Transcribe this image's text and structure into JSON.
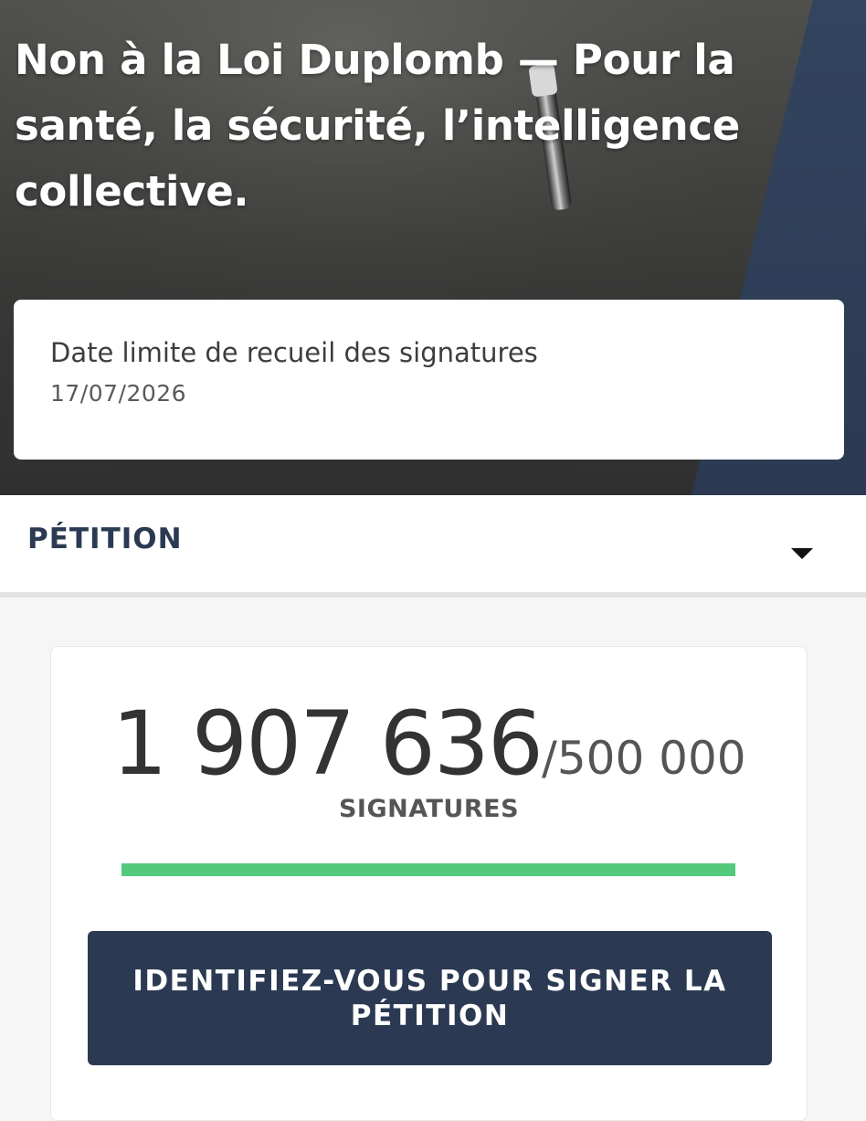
{
  "hero": {
    "title": "Non à la Loi Duplomb — Pour la santé, la sécurité, l’intelligence collective."
  },
  "deadline": {
    "label": "Date limite de recueil des signatures",
    "date": "17/07/2026"
  },
  "section": {
    "label": "PÉTITION",
    "toggle_icon": "caret-down-icon"
  },
  "signatures": {
    "count": "1 907 636",
    "goal": "/500 000",
    "label": "SIGNATURES",
    "progress_fraction": 1.0
  },
  "sign_button": {
    "label": "IDENTIFIEZ-VOUS POUR SIGNER LA PÉTITION"
  },
  "colors": {
    "navy": "#2b3a52",
    "progress_green": "#52c97b",
    "hero_dark": "#3c3c3b"
  }
}
